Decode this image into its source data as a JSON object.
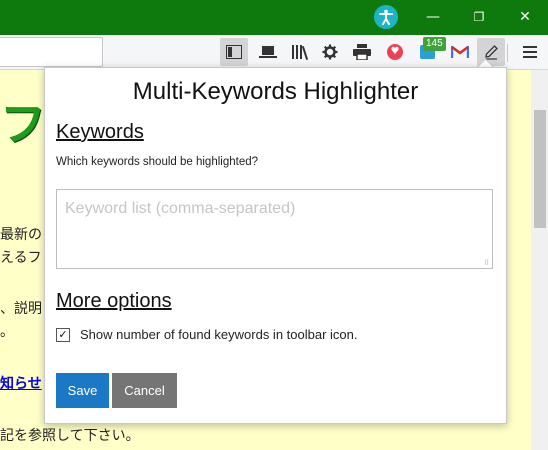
{
  "window": {
    "minimize_glyph": "—",
    "maximize_glyph": "❐",
    "close_glyph": "✕"
  },
  "toolbar": {
    "badge_count": "145",
    "pocket_glyph": "♥",
    "icons": [
      "sidebar-icon",
      "laptop-icon",
      "library-icon",
      "gear-icon",
      "printer-icon",
      "pocket-icon",
      "extension-icon",
      "gmail-icon",
      "pencil-icon",
      "menu-icon"
    ]
  },
  "background_page": {
    "logo_text": "フ",
    "lines": [
      "最新の",
      "えるフ",
      "、説明",
      "。",
      "知らせ",
      "記を参照して下さい。"
    ]
  },
  "popup": {
    "title": "Multi-Keywords Highlighter",
    "keywords_heading": "Keywords",
    "keywords_question": "Which keywords should be highlighted?",
    "keywords_placeholder": "Keyword list (comma-separated)",
    "keywords_value": "",
    "more_options_heading": "More options",
    "show_count_label": "Show number of found keywords in toolbar icon.",
    "show_count_checked": true,
    "save_label": "Save",
    "cancel_label": "Cancel"
  },
  "colors": {
    "titlebar": "#0e7a0d",
    "page_background": "#ffffc8",
    "save_button": "#1b78c4",
    "cancel_button": "#757575"
  }
}
